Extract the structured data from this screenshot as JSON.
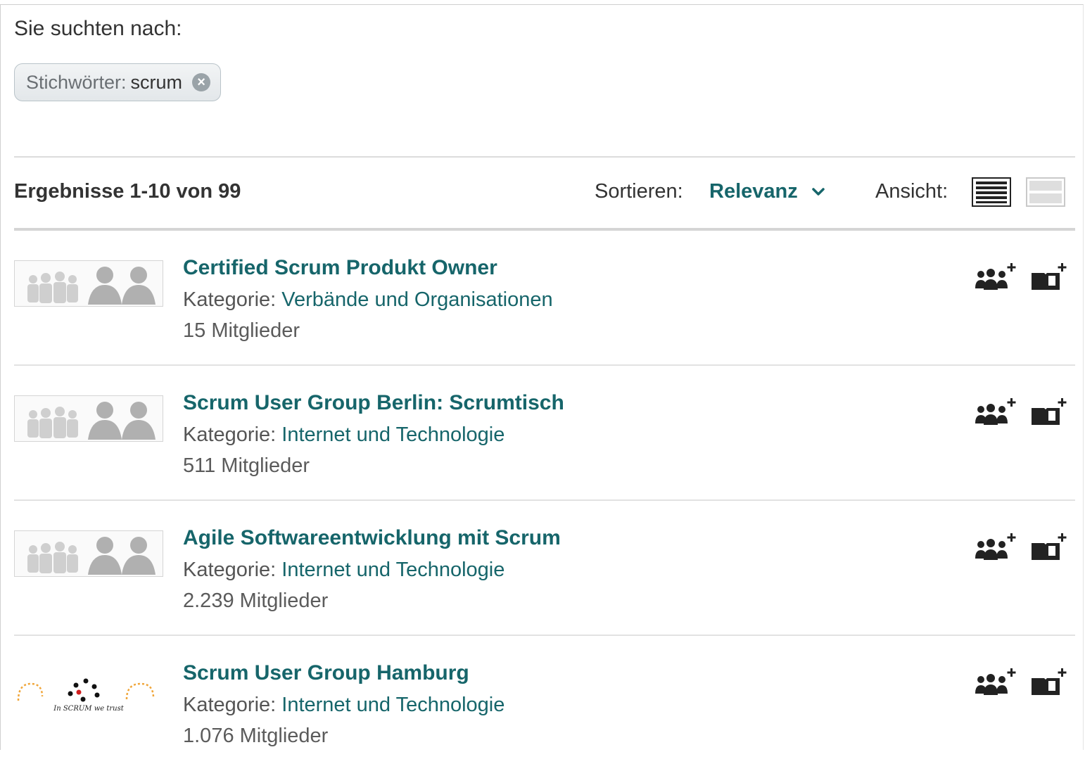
{
  "search": {
    "label": "Sie suchten nach:",
    "tag_key": "Stichwörter:",
    "tag_value": "scrum"
  },
  "toolbar": {
    "results_count": "Ergebnisse 1-10 von 99",
    "sort_label": "Sortieren:",
    "sort_value": "Relevanz",
    "view_label": "Ansicht:"
  },
  "colors": {
    "link": "#16656a",
    "text": "#333333",
    "muted": "#5b5b5b"
  },
  "groups": [
    {
      "title": "Certified Scrum Produkt Owner",
      "category_label": "Kategorie:",
      "category": "Verbände und Organisationen",
      "members": "15 Mitglieder",
      "thumbnail": "people-placeholder"
    },
    {
      "title": "Scrum User Group Berlin: Scrumtisch",
      "category_label": "Kategorie:",
      "category": "Internet und Technologie",
      "members": "511 Mitglieder",
      "thumbnail": "people-placeholder"
    },
    {
      "title": "Agile Softwareentwicklung mit Scrum",
      "category_label": "Kategorie:",
      "category": "Internet und Technologie",
      "members": "2.239 Mitglieder",
      "thumbnail": "people-placeholder"
    },
    {
      "title": "Scrum User Group Hamburg",
      "category_label": "Kategorie:",
      "category": "Internet und Technologie",
      "members": "1.076 Mitglieder",
      "thumbnail": "custom-logo",
      "logo_text": "In SCRUM we trust"
    }
  ]
}
